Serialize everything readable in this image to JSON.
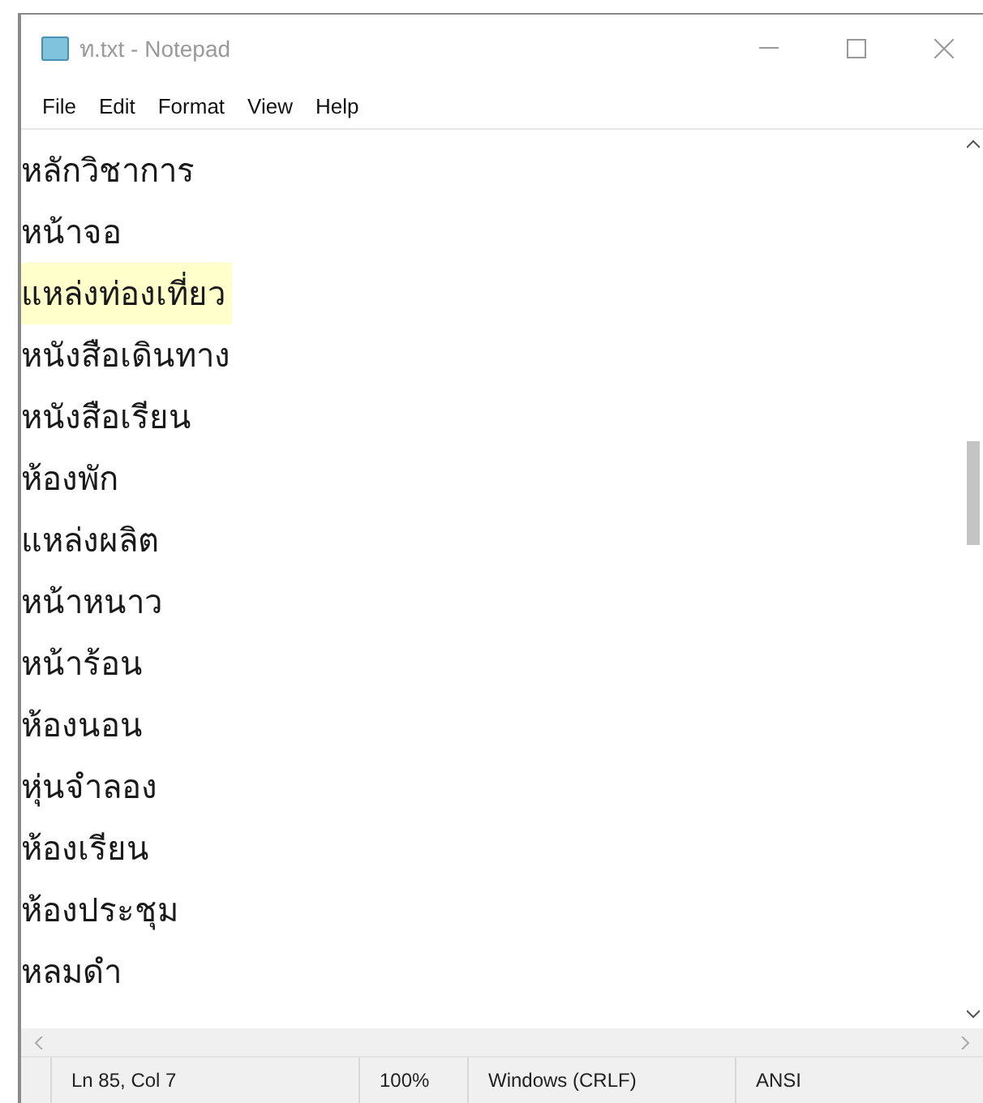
{
  "window": {
    "title": "ท.txt - Notepad"
  },
  "menu": [
    "File",
    "Edit",
    "Format",
    "View",
    "Help"
  ],
  "lines": [
    {
      "text": "หลักวิชาการ",
      "highlighted": false
    },
    {
      "text": "หน้าจอ",
      "highlighted": false
    },
    {
      "text": "แหล่งท่องเที่ยว",
      "highlighted": true
    },
    {
      "text": "หนังสือเดินทาง",
      "highlighted": false
    },
    {
      "text": "หนังสือเรียน",
      "highlighted": false
    },
    {
      "text": "ห้องพัก",
      "highlighted": false
    },
    {
      "text": "แหล่งผลิต",
      "highlighted": false
    },
    {
      "text": "หน้าหนาว",
      "highlighted": false
    },
    {
      "text": "หน้าร้อน",
      "highlighted": false
    },
    {
      "text": "ห้องนอน",
      "highlighted": false
    },
    {
      "text": "หุ่นจำลอง",
      "highlighted": false
    },
    {
      "text": "ห้องเรียน",
      "highlighted": false
    },
    {
      "text": "ห้องประชุม",
      "highlighted": false
    },
    {
      "text": "หลมดำ",
      "highlighted": false
    }
  ],
  "status_bar": [
    "Ln 85, Col 7",
    "100%",
    "Windows (CRLF)",
    "ANSI"
  ]
}
